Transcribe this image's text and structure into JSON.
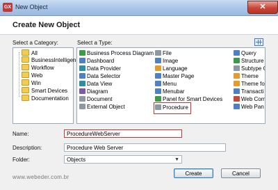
{
  "window": {
    "title": "New Object",
    "app_icon": "GX",
    "close_glyph": "✕"
  },
  "header": {
    "title": "Create New Object"
  },
  "category": {
    "label": "Select a Category:",
    "items": [
      "All",
      "BusinessIntelligen",
      "Workflow",
      "Web",
      "Win",
      "Smart Devices",
      "Documentation"
    ]
  },
  "types": {
    "label": "Select a Type:",
    "col1": [
      "Business Process Diagram",
      "Dashboard",
      "Data Provider",
      "Data Selector",
      "Data View",
      "Diagram",
      "Document",
      "External Object"
    ],
    "col2": [
      "File",
      "Image",
      "Language",
      "Master Page",
      "Menu",
      "Menubar",
      "Panel for Smart Devices",
      "Procedure"
    ],
    "col3": [
      "Query",
      "Structure",
      "Subtype G",
      "Theme",
      "Theme fo",
      "Transacti",
      "Web Com",
      "Web Pan"
    ],
    "selected": "Procedure"
  },
  "form": {
    "name_label": "Name:",
    "name_value": "ProcedureWebServer",
    "description_label": "Description:",
    "description_value": "Procedure Web Server",
    "folder_label": "Folder:",
    "folder_value": "Objects"
  },
  "buttons": {
    "create": "Create",
    "cancel": "Cancel"
  },
  "watermark": "www.webeder.com.br",
  "colors": {
    "highlight": "#d0312d",
    "titlebar": "#a9c4e6",
    "close": "#c8473a"
  }
}
